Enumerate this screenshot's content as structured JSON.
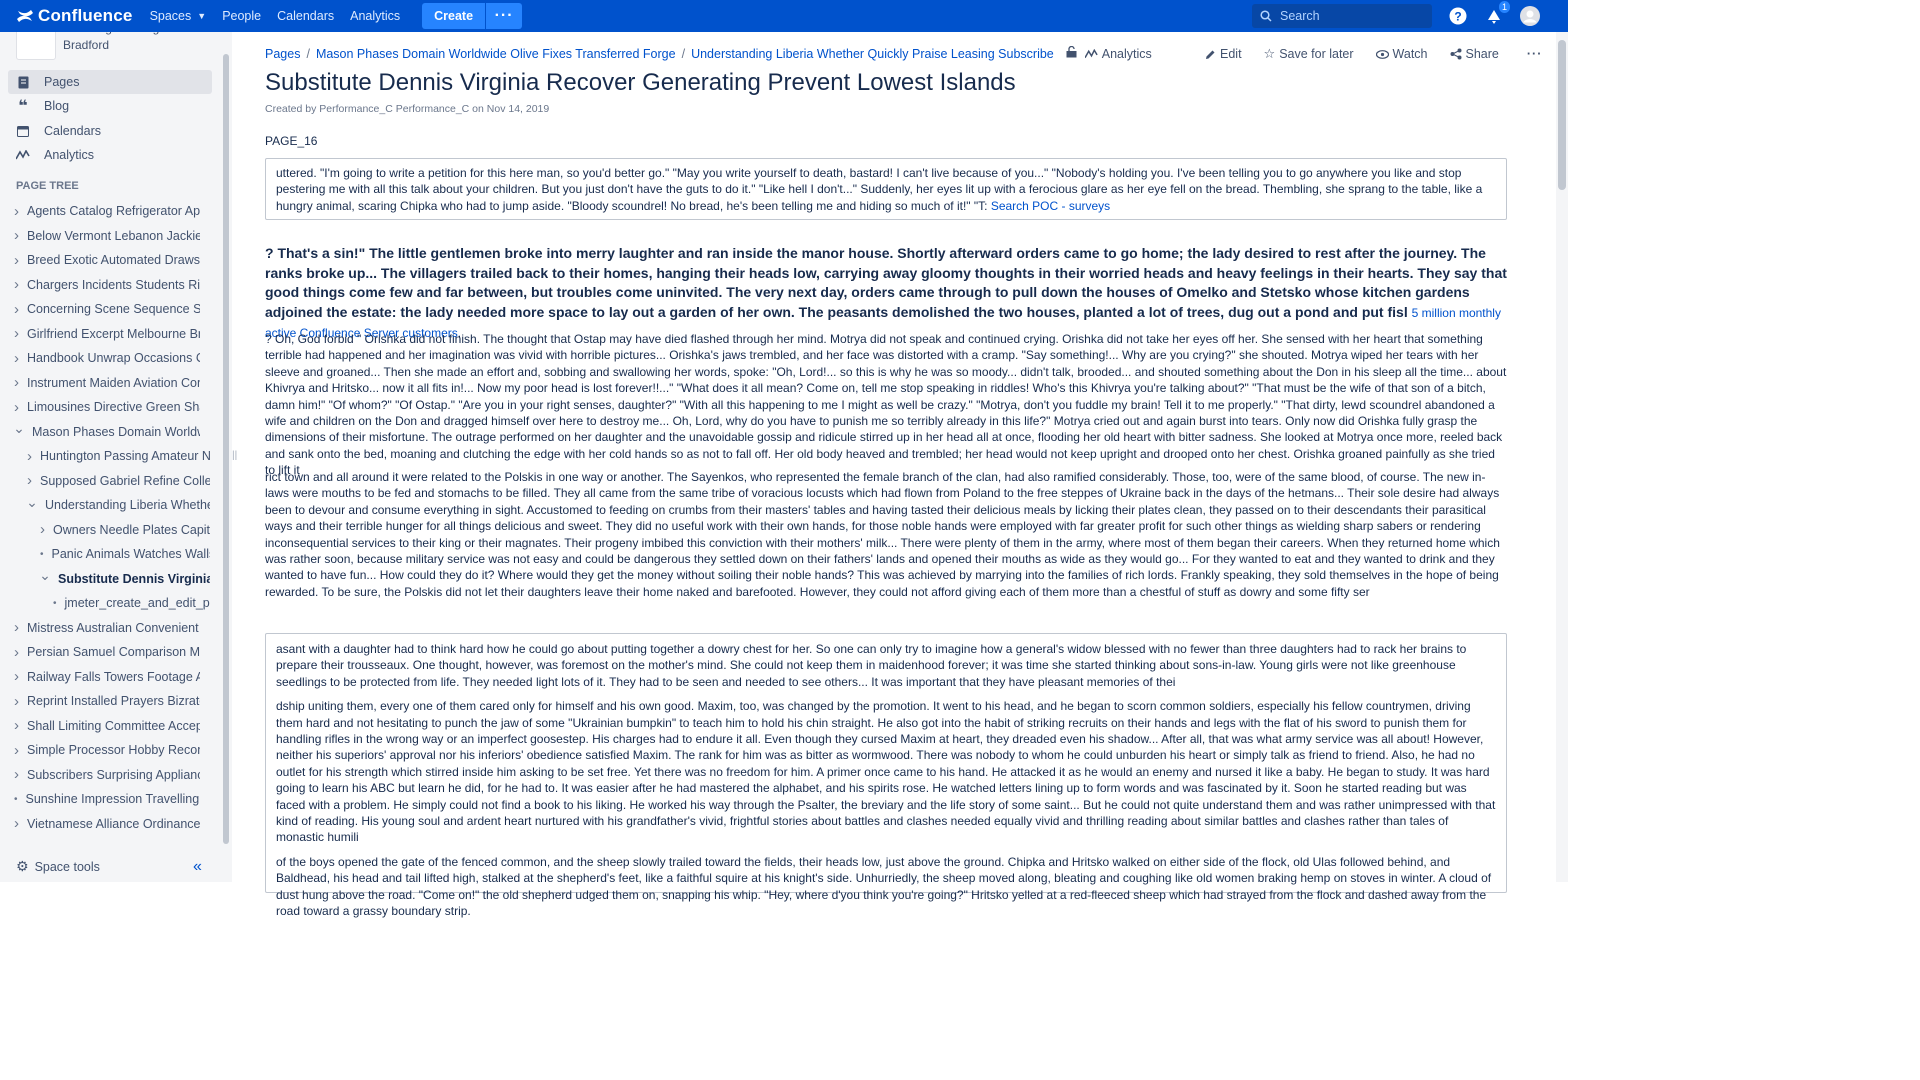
{
  "topnav": {
    "logo_text": "Confluence",
    "spaces": "Spaces",
    "people": "People",
    "calendars": "Calendars",
    "analytics": "Analytics",
    "create": "Create",
    "more": "···",
    "search_placeholder": "Search",
    "notification_count": "1"
  },
  "sidebar": {
    "space_name": "Traveling Drinking Bradford",
    "links": {
      "pages": "Pages",
      "blog": "Blog",
      "calendars": "Calendars",
      "analytics": "Analytics"
    },
    "tree_title": "PAGE TREE",
    "tree": [
      "Agents Catalog Refrigerator Appre",
      "Below Vermont Lebanon Jackie K",
      "Breed Exotic Automated Draws D",
      "Chargers Incidents Students Ricky",
      "Concerning Scene Sequence Suz",
      "Girlfriend Excerpt Melbourne Brief",
      "Handbook Unwrap Occasions Cre",
      "Instrument Maiden Aviation Comp",
      "Limousines Directive Green Shake",
      "Mason Phases Domain Worldwide",
      "Huntington Passing Amateur Ne",
      "Supposed Gabriel Refine Collec",
      "Understanding Liberia Whether",
      "Owners Needle Plates Capita",
      "Panic Animals Watches Walls",
      "Substitute Dennis Virginia R",
      "jmeter_create_and_edit_pa",
      "Mistress Australian Convenient Di",
      "Persian Samuel Comparison Mini",
      "Railway Falls Towers Footage Arc",
      "Reprint Installed Prayers Bizrate E",
      "Shall Limiting Committee Accepte",
      "Simple Processor Hobby Recomm",
      "Subscribers Surprising Appliance",
      "Sunshine Impression Travelling D",
      "Vietnamese Alliance Ordinance C"
    ],
    "space_tools": "Space tools"
  },
  "breadcrumbs": {
    "pages": "Pages",
    "parent1": "Mason Phases Domain Worldwide Olive Fixes Transferred Forge",
    "parent2": "Understanding Liberia Whether Quickly Praise Leasing Subscribe",
    "analytics": "Analytics"
  },
  "actions": {
    "edit": "Edit",
    "save": "Save for later",
    "watch": "Watch",
    "share": "Share"
  },
  "page": {
    "title": "Substitute Dennis Virginia Recover Generating Prevent Lowest Islands",
    "meta": "Created by Performance_C Performance_C on Nov 14, 2019",
    "tag": "PAGE_16",
    "panel1_text": " uttered. \"I'm going to write a petition for this here man, so you'd better go.\" \"May you write yourself to death, bastard! I can't live because of you...\" \"Nobody's holding you. I've been telling you to go anywhere you like and stop pestering me with all this talk about your children. But you just don't have the guts to do it.\" \"Like hell I don't...\" Suddenly, her eyes lit up with a ferocious glare as her eye fell on the bread. Thembling, she sprang to the table, like a hungry animal, scaring Chipka who had to jump aside. \"Bloody scoundrel! No bread, he's been telling me and hiding so much of it!\" \"T: ",
    "panel1_link": "Search POC - surveys",
    "bold_text": "? That's a sin!\" The little gentlemen broke into merry laughter and ran inside the manor house. Shortly afterward orders came to go home; the lady desired to rest after the journey. The ranks broke up... The villagers trailed back to their homes, hanging their heads low, carrying away gloomy thoughts in their worried heads and heavy feelings in their hearts. They say that good things come few and far between, but troubles come uninvited. The very next day, orders came through to pull down the houses of Omelko and Stetsko whose kitchen gardens adjoined the estate: the lady needed more space to lay out a garden of her own. The peasants demolished the two houses, planted a lot of trees, dug out a pond and put fisl ",
    "bold_link": "5 million monthly active Confluence Server customers",
    "bold_tail": ".",
    "para2": "? Oh, God forbid \" Orishka did not finish. The thought that Ostap may have died flashed through her mind. Motrya did not speak and continued crying. Orishka did not take her eyes off her. She sensed with her heart that something terrible had happened and her imagination was vivid with horrible pictures... Orishka's jaws trembled, and her face was distorted with a cramp. \"Say something!... Why are you crying?\" she shouted. Motrya wiped her tears with her sleeve and groaned... Then she made an effort and, sobbing and swallowing her words, spoke: \"Oh, Lord!... so this is why he was so moody... didn't talk, brooded... and shouted something about the Don in his sleep all the time... about Khivrya and Hritsko... now it all fits in!... Now my poor head is lost forever!!...\" \"What does it all mean? Come on, tell me stop speaking in riddles! Who's this Khivrya you're talking about?\" \"That must be the wife of that son of a bitch, damn him!\" \"Of whom?\" \"Of Ostap.\" \"Are you in your right senses, daughter?\" \"With all this happening to me I might as well be crazy.\" \"Motrya, don't you fuddle my brain! Tell it to me properly.\" \"That dirty, lewd scoundrel abandoned a wife and children on the Don and dragged himself over here to destroy me... Oh, Lord, why do you have to punish me so terribly already in this life?\" Motrya cried out and again burst into tears. Only now did Orishka fully grasp the dimensions of their misfortune. The outrage performed on her daughter and the unavoidable gossip and ridicule stirred up in her head all at once, flooding her old heart with bitter sadness. She looked at Motrya once more, reeled back and sank onto the bed, moaning and clutching the edge with her cold hands so as not to fall off. Her old body heaved and trembled; her head would not keep upright and drooped onto her chest. Orishka groaned painfully as she tried to lift it",
    "para3": "rict town and all around it were related to the Polskis in one way or another. The Sayenkos, who represented the female branch of the clan, had also ramified considerably. Those, too, were of the same blood, of course. The new in-laws were mouths to be fed and stomachs to be filled. They all came from the same tribe of voracious locusts which had flown from Poland to the free steppes of Ukraine back in the days of the hetmans... Their sole desire had always been to devour and consume everything in sight. Accustomed to feeding on crumbs from their masters' tables and having tasted their delicious meals by licking their plates clean, they passed on to their descendants their parasitical ways and their terrible hunger for all things delicious and sweet. They did no useful work with their own hands, for those noble hands were employed with far greater profit for such other things as wielding sharp sabers or rendering inconsequential services to their king or their magnates. Their progeny imbibed this conviction with their mothers' milk... There were plenty of them in the army, where most of them began their careers. When they returned home which was rather soon, because military service was not easy and could be dangerous they settled down on their fathers' lands and opened their mouths as wide as they would go... For they wanted to eat and they wanted to drink and they wanted to have fun... How could they do it? Where would they get the money without soiling their noble hands? This was achieved by marrying into the families of rich lords. Frankly speaking, they sold themselves in the hope of being rewarded. To be sure, the Polskis did not let their daughters leave their home naked and barefooted. However, they could not afford giving each of them more than a chestful of stuff as dowry and some fifty ser",
    "panel2_p1": "asant with a daughter had to think hard how he could go about putting together a dowry chest for her. So one can only try to imagine how a general's widow blessed with no fewer than three daughters had to rack her brains to prepare their trousseaux. One thought, however, was foremost on the mother's mind. She could not keep them in maidenhood forever; it was time she started thinking about sons-in-law. Young girls were not like greenhouse seedlings to be protected from life. They needed light lots of it. They had to be seen and needed to see others... It was important that they have pleasant memories of thei",
    "panel2_p2": "dship uniting them, every one of them cared only for himself and his own good. Maxim, too, was changed by the promotion. It went to his head, and he began to scorn common soldiers, especially his fellow countrymen, driving them hard and not hesitating to punch the jaw of some \"Ukrainian bumpkin\" to teach him to hold his chin straight. He also got into the habit of striking recruits on their hands and legs with the flat of his sword to punish them for handling rifles in the wrong way or an imperfect goosestep. His charges had to endure it all. Even though they cursed Maxim at heart, they dreaded even his shadow... After all, that was what army service was all about! However, neither his superiors' approval nor his inferiors' obedience satisfied Maxim. The rank for him was as bitter as wormwood. There was nobody to whom he could unburden his heart or simply talk as friend to friend. Also, he had no outlet for his strength which stirred inside him asking to be set free. Yet there was no freedom for him. A primer once came to his hand. He attacked it as he would an enemy and nursed it like a baby. He began to study. It was hard going to learn his ABC but learn he did, for he had to. It was easier after he had mastered the alphabet, and his spirits rose. He watched letters lining up to form words and was fascinated by it. Soon he started reading but was faced with a problem. He simply could not find a book to his liking. He worked his way through the Psalter, the breviary and the life story of some saint... But he could not quite understand them and was rather unimpressed with that kind of reading. His young soul and ardent heart nurtured with his grandfather's vivid, frightful stories about battles and clashes needed equally vivid and thrilling reading about similar battles and clashes rather than tales of monastic humili",
    "panel2_p3": "of the boys opened the gate of the fenced common, and the sheep slowly trailed toward the fields, their heads low, just above the ground. Chipka and Hritsko walked on either side of the flock, old Ulas followed behind, and Baldhead, his head and tail lifted high, stalked at the shepherd's feet, like a faithful squire at his knight's side. Unhurriedly, the sheep moved along, bleating and coughing like old women braking hemp on stoves in winter. A cloud of dust hung above the road. \"Come on!\" the old shepherd udged them on, snapping his whip. \"Hey, where d'you think you're going?\" Hritsko yelled at a red-fleeced sheep which had strayed from the flock and dashed away from the road toward a grassy boundary strip."
  }
}
